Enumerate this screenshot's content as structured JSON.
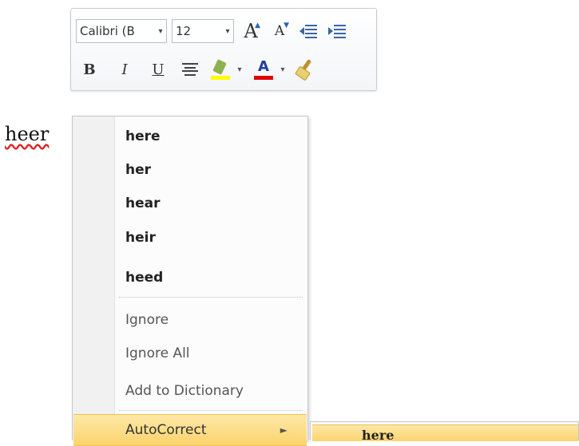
{
  "mini_toolbar": {
    "font_name": "Calibri (B",
    "font_size": "12",
    "grow_font_icon": "A",
    "shrink_font_icon": "A",
    "bold_label": "B",
    "italic_label": "I",
    "underline_label": "U",
    "font_color_icon": "A",
    "highlight_color": "#ffff00",
    "font_color": "#e00000"
  },
  "document": {
    "misspelled_word": "heer"
  },
  "context_menu": {
    "suggestions": [
      "here",
      "her",
      "hear",
      "heir",
      "heed"
    ],
    "ignore_label": "Ignore",
    "ignore_all_label": "Ignore All",
    "add_to_dictionary_label": "Add to Dictionary",
    "autocorrect_label": "AutoCorrect",
    "highlight_color": "#fbd46c"
  },
  "autocorrect_submenu": {
    "items": [
      "here"
    ]
  }
}
